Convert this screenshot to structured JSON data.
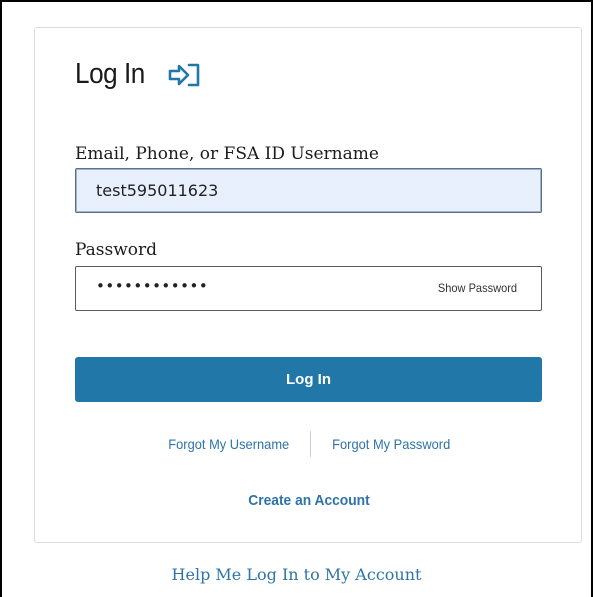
{
  "login_form": {
    "title": "Log In",
    "title_icon": "sign-in-arrow-icon",
    "email": {
      "label": "Email, Phone, or FSA ID Username",
      "value": "test595011623"
    },
    "password": {
      "label": "Password",
      "masked_value": "••••••••••••",
      "show_label": "Show Password"
    },
    "submit_label": "Log In",
    "forgot_username": "Forgot My Username",
    "forgot_password": "Forgot My Password",
    "create_account": "Create an Account"
  },
  "help_link": "Help Me Log In to My Account",
  "colors": {
    "primary_button": "#2177a8",
    "link": "#2e74a8",
    "autofill_bg": "#e8f0fe"
  }
}
